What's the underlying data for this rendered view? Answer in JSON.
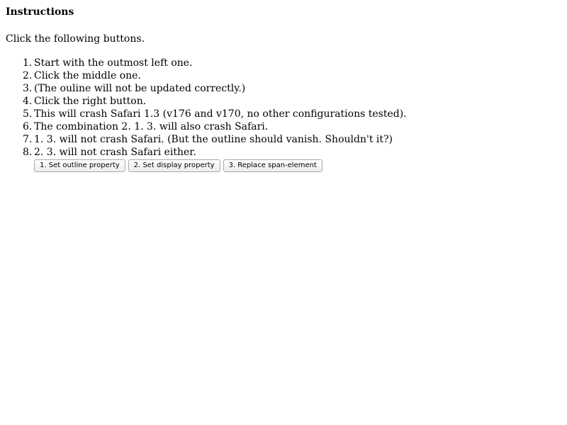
{
  "heading": "Instructions",
  "intro": "Click the following buttons.",
  "steps": [
    {
      "num": "1.",
      "text": "Start with the outmost left one."
    },
    {
      "num": "2.",
      "text": "Click the middle one."
    },
    {
      "num": "3.",
      "text": "(The ouline will not be updated correctly.)"
    },
    {
      "num": "4.",
      "text": "Click the right button."
    },
    {
      "num": "5.",
      "text": "This will crash Safari 1.3 (v176 and v170, no other configurations tested)."
    },
    {
      "num": "6.",
      "text": "The combination 2. 1. 3. will also crash Safari."
    },
    {
      "num": "7.",
      "text": "1. 3. will not crash Safari. (But the outline should vanish. Shouldn't it?)"
    },
    {
      "num": "8.",
      "text": "2. 3. will not crash Safari either."
    }
  ],
  "buttons": {
    "outline_label": "1. Set outline property",
    "display_label": "2. Set display property",
    "replace_label": "3. Replace span-element"
  }
}
